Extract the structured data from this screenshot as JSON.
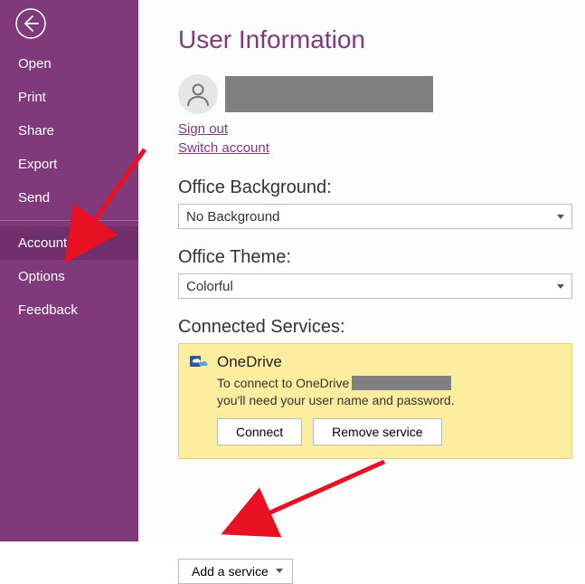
{
  "sidebar": {
    "items": [
      {
        "label": "Open"
      },
      {
        "label": "Print"
      },
      {
        "label": "Share"
      },
      {
        "label": "Export"
      },
      {
        "label": "Send"
      },
      {
        "label": "Account"
      },
      {
        "label": "Options"
      },
      {
        "label": "Feedback"
      }
    ],
    "selected_index": 5
  },
  "page": {
    "title": "User Information",
    "sign_out": "Sign out",
    "switch_account": "Switch account",
    "bg_heading": "Office Background:",
    "bg_value": "No Background",
    "theme_heading": "Office Theme:",
    "theme_value": "Colorful",
    "services_heading": "Connected Services:",
    "add_service": "Add a service"
  },
  "service": {
    "name": "OneDrive",
    "desc_pre": "To connect to OneDrive",
    "desc_post": "you'll need your user name and password.",
    "connect": "Connect",
    "remove": "Remove service"
  },
  "colors": {
    "accent": "#80397b"
  }
}
